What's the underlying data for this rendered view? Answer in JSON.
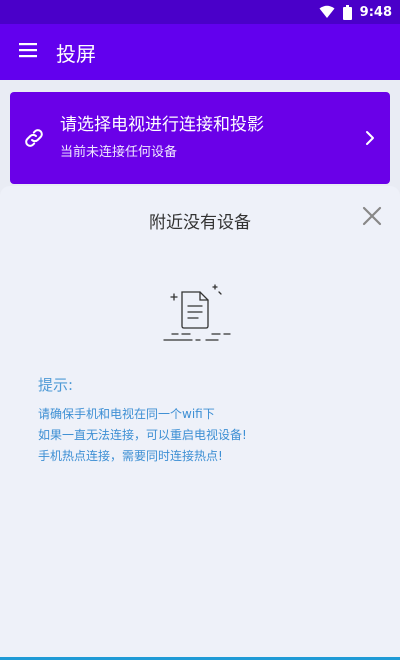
{
  "status_bar": {
    "time": "9:48",
    "icons": [
      "wifi-icon",
      "battery-icon"
    ]
  },
  "app_bar": {
    "menu_icon": "menu-icon",
    "title": "投屏"
  },
  "connect_card": {
    "icon": "link-icon",
    "title": "请选择电视进行连接和投影",
    "subtitle": "当前未连接任何设备",
    "chevron_icon": "chevron-right-icon"
  },
  "sheet": {
    "title": "附近没有设备",
    "close_icon": "close-icon",
    "illustration_icon": "empty-document-icon",
    "tips_heading": "提示:",
    "tips": [
      "请确保手机和电视在同一个wifi下",
      "如果一直无法连接，可以重启电视设备!",
      "手机热点连接，需要同时连接热点!"
    ]
  },
  "colors": {
    "status_bar": "#4a00c9",
    "app_bar": "#6200ee",
    "card": "#6a00e8",
    "sheet_bg": "#eef1f9",
    "tip_text": "#3d8fd4"
  }
}
